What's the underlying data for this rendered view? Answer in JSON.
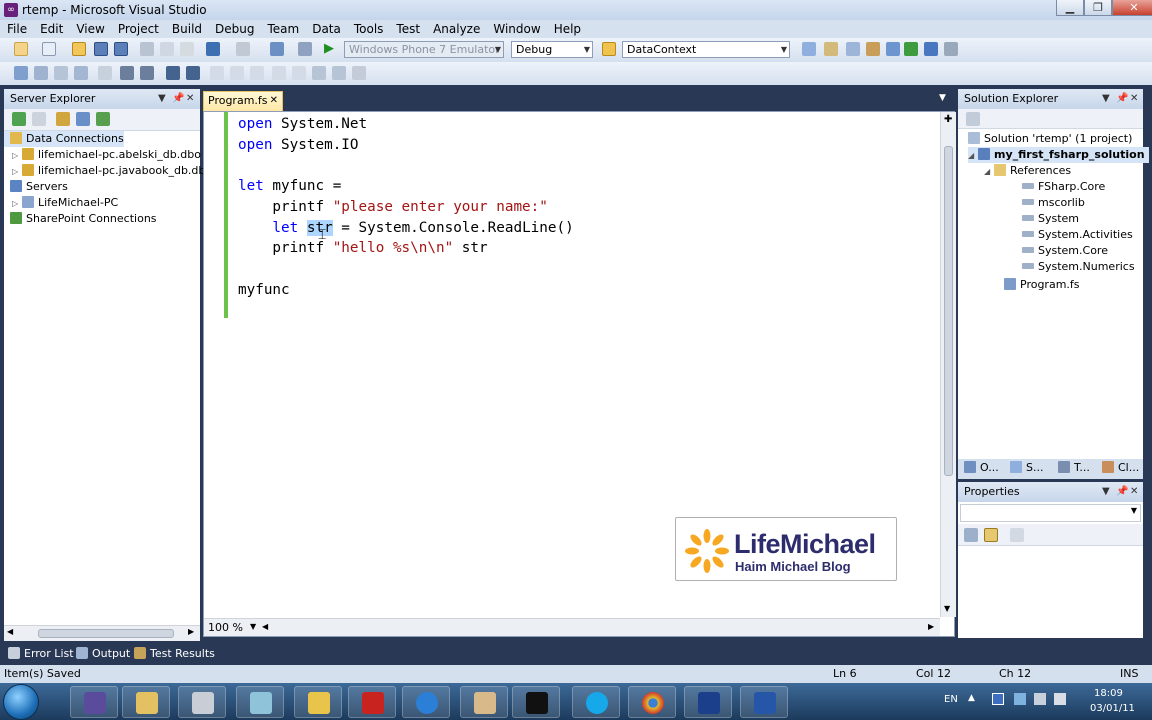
{
  "window": {
    "title": "rtemp - Microsoft Visual Studio",
    "minimize": "▁",
    "restore": "❐",
    "close": "✕"
  },
  "menu": [
    "File",
    "Edit",
    "View",
    "Project",
    "Build",
    "Debug",
    "Team",
    "Data",
    "Tools",
    "Test",
    "Analyze",
    "Window",
    "Help"
  ],
  "toolbar": {
    "device_target": "Windows Phone 7 Emulator",
    "configuration": "Debug",
    "find_combo": "DataContext"
  },
  "server_explorer": {
    "title": "Server Explorer",
    "items": [
      {
        "label": "Data Connections"
      },
      {
        "label": "lifemichael-pc.abelski_db.dbo"
      },
      {
        "label": "lifemichael-pc.javabook_db.dbo"
      },
      {
        "label": "Servers"
      },
      {
        "label": "LifeMichael-PC"
      },
      {
        "label": "SharePoint Connections"
      }
    ]
  },
  "editor": {
    "tab_label": "Program.fs",
    "zoom": "100 %",
    "code": {
      "l1_kw": "open",
      "l1_rest": " System.Net",
      "l2_kw": "open",
      "l2_rest": " System.IO",
      "l4_kw": "let",
      "l4_rest": " myfunc =",
      "l5_fn": "    printf ",
      "l5_str": "\"please enter your name:\"",
      "l6_kw": "    let",
      "l6_sel": "str",
      "l6_rest": " = System.Console.ReadLine()",
      "l7_fn": "    printf ",
      "l7_str": "\"hello %s\\n\\n\"",
      "l7_rest": " str",
      "l9": "myfunc"
    }
  },
  "logo": {
    "name": "LifeMichael",
    "subtitle": "Haim Michael Blog"
  },
  "solution_explorer": {
    "title": "Solution Explorer",
    "items": [
      {
        "label": "Solution 'rtemp' (1 project)"
      },
      {
        "label": "my_first_fsharp_solution"
      },
      {
        "label": "References"
      },
      {
        "label": "FSharp.Core"
      },
      {
        "label": "mscorlib"
      },
      {
        "label": "System"
      },
      {
        "label": "System.Activities"
      },
      {
        "label": "System.Core"
      },
      {
        "label": "System.Numerics"
      },
      {
        "label": "Program.fs"
      }
    ],
    "tabs": [
      "O...",
      "S...",
      "T...",
      "Cl..."
    ]
  },
  "properties": {
    "title": "Properties"
  },
  "bottom_tabs": [
    "Error List",
    "Output",
    "Test Results"
  ],
  "status": {
    "message": "Item(s) Saved",
    "ln": "Ln 6",
    "col": "Col 12",
    "ch": "Ch 12",
    "mode": "INS"
  },
  "taskbar": {
    "lang": "EN",
    "time": "18:09",
    "date": "03/01/11"
  }
}
